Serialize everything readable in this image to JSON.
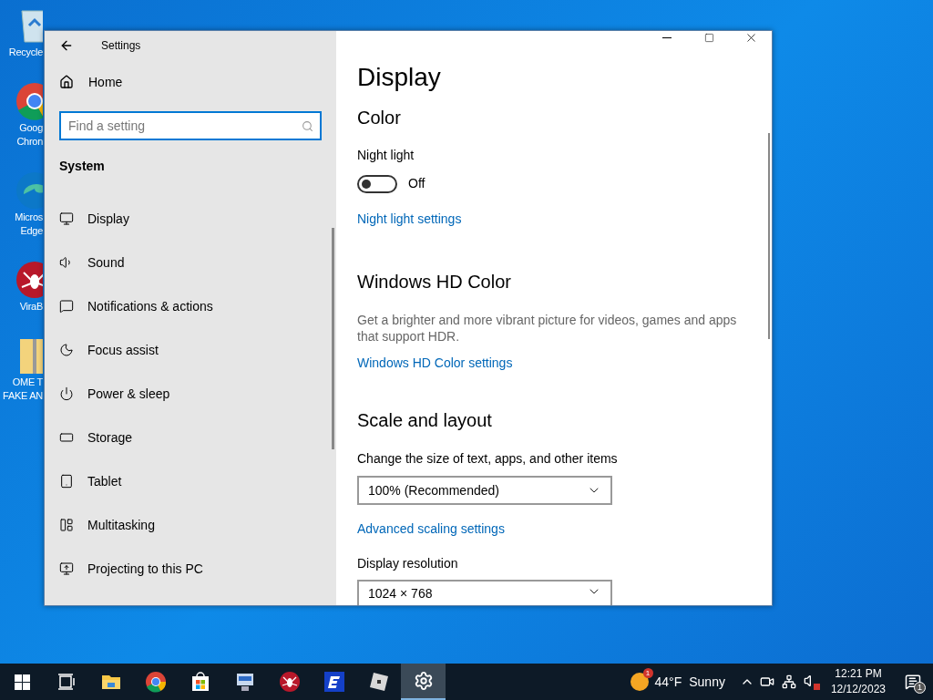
{
  "desktop": {
    "icons": [
      {
        "kind": "recycle",
        "lines": [
          "Recycle"
        ]
      },
      {
        "kind": "chrome",
        "lines": [
          "Goog",
          "Chron"
        ]
      },
      {
        "kind": "edge",
        "lines": [
          "Micros",
          "Edge"
        ]
      },
      {
        "kind": "spider",
        "lines": [
          "ViraB"
        ]
      },
      {
        "kind": "folder",
        "lines": [
          "OME T",
          "FAKE AN"
        ]
      }
    ]
  },
  "window": {
    "title": "Settings",
    "sidebar": {
      "home": "Home",
      "search": {
        "placeholder": "Find a setting"
      },
      "section": "System",
      "items": [
        {
          "kind": "display",
          "label": "Display"
        },
        {
          "kind": "sound",
          "label": "Sound"
        },
        {
          "kind": "notifications",
          "label": "Notifications & actions"
        },
        {
          "kind": "focus",
          "label": "Focus assist"
        },
        {
          "kind": "power",
          "label": "Power & sleep"
        },
        {
          "kind": "storage",
          "label": "Storage"
        },
        {
          "kind": "tablet",
          "label": "Tablet"
        },
        {
          "kind": "multitasking",
          "label": "Multitasking"
        },
        {
          "kind": "projecting",
          "label": "Projecting to this PC"
        }
      ]
    },
    "content": {
      "title": "Display",
      "color": {
        "heading": "Color",
        "night_light": {
          "label": "Night light",
          "on": false,
          "state": "Off"
        },
        "link": "Night light settings"
      },
      "hd_color": {
        "heading": "Windows HD Color",
        "description": "Get a brighter and more vibrant picture for videos, games and apps that support HDR.",
        "link": "Windows HD Color settings"
      },
      "scale": {
        "heading": "Scale and layout",
        "size_label": "Change the size of text, apps, and other items",
        "size_value": "100% (Recommended)",
        "link": "Advanced scaling settings",
        "resolution_label": "Display resolution",
        "resolution_value": "1024 × 768"
      }
    }
  },
  "taskbar": {
    "apps": [
      {
        "kind": "taskview",
        "selected": false
      },
      {
        "kind": "explorer",
        "selected": false
      },
      {
        "kind": "chrome",
        "selected": false
      },
      {
        "kind": "store",
        "selected": false
      },
      {
        "kind": "remote",
        "selected": false
      },
      {
        "kind": "spider",
        "selected": false
      },
      {
        "kind": "e",
        "selected": false
      },
      {
        "kind": "roblox",
        "selected": false
      },
      {
        "kind": "settings",
        "selected": true
      }
    ],
    "weather": {
      "badge": "1",
      "temperature": "44°F",
      "condition": "Sunny"
    },
    "clock": {
      "time": "12:21 PM",
      "date": "12/12/2023"
    },
    "notifications": {
      "count": "1"
    }
  }
}
